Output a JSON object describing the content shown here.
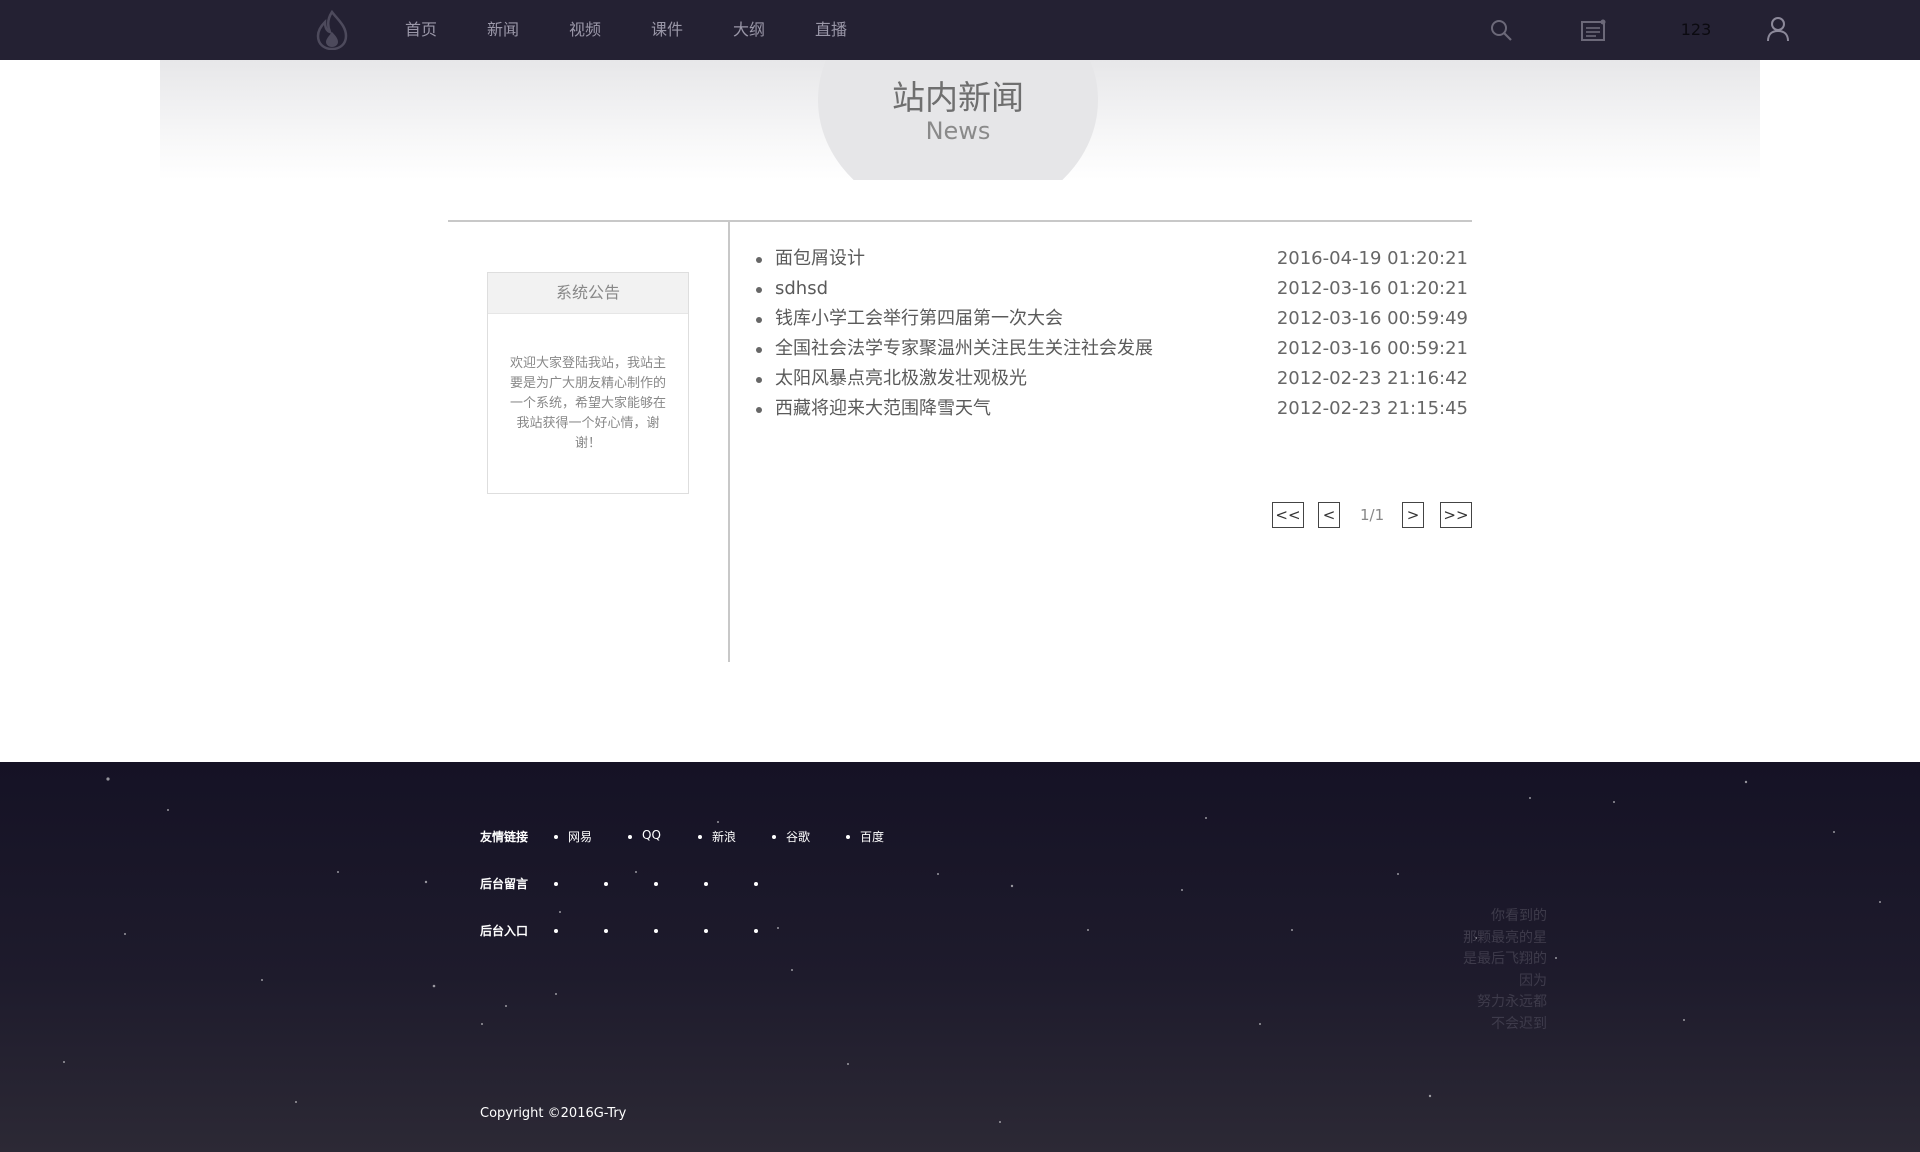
{
  "nav": {
    "items": [
      "首页",
      "新闻",
      "视频",
      "课件",
      "大纲",
      "直播"
    ],
    "username": "123"
  },
  "banner": {
    "title": "站内新闻",
    "subtitle": "News"
  },
  "notice": {
    "title": "系统公告",
    "body": "欢迎大家登陆我站，我站主要是为广大朋友精心制作的一个系统，希望大家能够在我站获得一个好心情，谢谢！"
  },
  "news": [
    {
      "title": "面包屑设计",
      "date": "2016-04-19 01:20:21"
    },
    {
      "title": "sdhsd",
      "date": "2012-03-16 01:20:21"
    },
    {
      "title": "钱库小学工会举行第四届第一次大会",
      "date": "2012-03-16 00:59:49"
    },
    {
      "title": "全国社会法学专家聚温州关注民生关注社会发展",
      "date": "2012-03-16 00:59:21"
    },
    {
      "title": "太阳风暴点亮北极激发壮观极光",
      "date": "2012-02-23 21:16:42"
    },
    {
      "title": "西藏将迎来大范围降雪天气",
      "date": "2012-02-23 21:15:45"
    }
  ],
  "pager": {
    "first": "<<",
    "prev": "<",
    "info": "1/1",
    "next": ">",
    "last": ">>"
  },
  "footer": {
    "links_label": "友情链接",
    "links": [
      "网易",
      "QQ",
      "新浪",
      "谷歌",
      "百度"
    ],
    "guestbook_label": "后台留言",
    "admin_label": "后台入口",
    "poem": [
      "你看到的",
      "那颗最亮的星",
      "是最后飞翔的",
      "因为",
      "努力永远都",
      "不会迟到"
    ],
    "copyright": "Copyright ©2016G-Try"
  }
}
